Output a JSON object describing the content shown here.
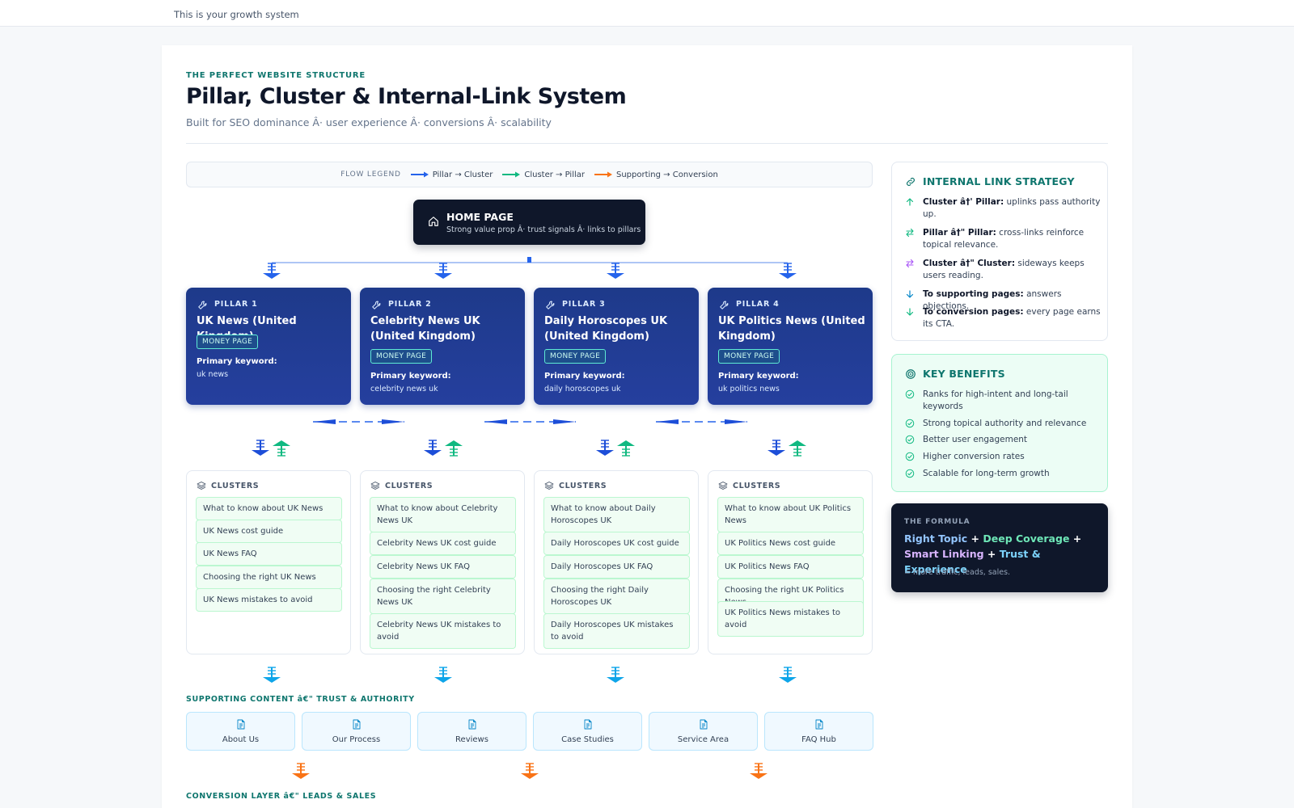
{
  "topbar": {
    "text": "This is your growth system"
  },
  "header": {
    "eyebrow": "THE PERFECT WEBSITE STRUCTURE",
    "title": "Pillar, Cluster & Internal-Link System",
    "subtitle": "Built for SEO dominance Â· user experience Â· conversions Â· scalability"
  },
  "legend": {
    "title": "FLOW LEGEND",
    "items": [
      {
        "label": "Pillar → Cluster",
        "color": "#2563eb"
      },
      {
        "label": "Cluster → Pillar",
        "color": "#10b981"
      },
      {
        "label": "Supporting → Conversion",
        "color": "#f97316"
      }
    ]
  },
  "home": {
    "title": "HOME PAGE",
    "subtitle": "Strong value prop Â· trust signals Â· links to pillars"
  },
  "pillars": [
    {
      "num": "PILLAR 1",
      "name": "UK News (United Kingdom)",
      "badge": "MONEY PAGE",
      "kw_label": "Primary keyword:",
      "kw": "uk news"
    },
    {
      "num": "PILLAR 2",
      "name": "Celebrity News UK (United Kingdom)",
      "badge": "MONEY PAGE",
      "kw_label": "Primary keyword:",
      "kw": "celebrity news uk"
    },
    {
      "num": "PILLAR 3",
      "name": "Daily Horoscopes UK (United Kingdom)",
      "badge": "MONEY PAGE",
      "kw_label": "Primary keyword:",
      "kw": "daily horoscopes uk"
    },
    {
      "num": "PILLAR 4",
      "name": "UK Politics News (United Kingdom)",
      "badge": "MONEY PAGE",
      "kw_label": "Primary keyword:",
      "kw": "uk politics news"
    }
  ],
  "clusters": [
    {
      "title": "CLUSTERS",
      "items": [
        "What to know about UK News",
        "UK News cost guide",
        "UK News FAQ",
        "Choosing the right UK News",
        "UK News mistakes to avoid"
      ]
    },
    {
      "title": "CLUSTERS",
      "items": [
        "What to know about Celebrity News UK",
        "Celebrity News UK cost guide",
        "Celebrity News UK FAQ",
        "Choosing the right Celebrity News UK",
        "Celebrity News UK mistakes to avoid"
      ]
    },
    {
      "title": "CLUSTERS",
      "items": [
        "What to know about Daily Horoscopes UK",
        "Daily Horoscopes UK cost guide",
        "Daily Horoscopes UK FAQ",
        "Choosing the right Daily Horoscopes UK",
        "Daily Horoscopes UK mistakes to avoid"
      ]
    },
    {
      "title": "CLUSTERS",
      "items": [
        "What to know about UK Politics News",
        "UK Politics News cost guide",
        "UK Politics News FAQ",
        "Choosing the right UK Politics News",
        "UK Politics News mistakes to avoid"
      ]
    }
  ],
  "supporting": {
    "label": "SUPPORTING CONTENT â€\" TRUST & AUTHORITY",
    "items": [
      "About Us",
      "Our Process",
      "Reviews",
      "Case Studies",
      "Service Area",
      "FAQ Hub"
    ]
  },
  "conversion": {
    "label": "CONVERSION LAYER â€\" LEADS & SALES"
  },
  "strategy": {
    "title": "INTERNAL LINK STRATEGY",
    "rows": [
      {
        "icon": "arrow-up-icon",
        "bold": "Cluster â†' Pillar:",
        "text": " uplinks pass authority up."
      },
      {
        "icon": "swap-icon",
        "bold": "Pillar â†\" Pillar:",
        "text": " cross-links reinforce topical relevance."
      },
      {
        "icon": "sideways-icon",
        "bold": "Cluster â†\" Cluster:",
        "text": " sideways keeps users reading."
      },
      {
        "icon": "arrow-down-icon",
        "bold": "To supporting pages:",
        "text": " answers objections."
      },
      {
        "icon": "arrow-down-icon",
        "bold": "To conversion pages:",
        "text": " every page earns its CTA."
      }
    ]
  },
  "benefits": {
    "title": "KEY BENEFITS",
    "items": [
      "Ranks for high-intent and long-tail keywords",
      "Strong topical authority and relevance",
      "Better user engagement",
      "Higher conversion rates",
      "Scalable for long-term growth"
    ]
  },
  "formula": {
    "tag": "THE FORMULA",
    "parts": [
      {
        "text": "Right Topic",
        "color": "#93c5fd"
      },
      {
        "text": " + ",
        "color": "#ffffff"
      },
      {
        "text": "Deep Coverage",
        "color": "#6ee7b7"
      },
      {
        "text": " + ",
        "color": "#ffffff"
      },
      {
        "text": "Smart Linking",
        "color": "#d8b4fe"
      },
      {
        "text": " + ",
        "color": "#ffffff"
      },
      {
        "text": "Trust & Experience",
        "color": "#7dd3fc"
      }
    ],
    "note": "= more traffic, leads, sales."
  },
  "colors": {
    "pillar_blue": "#1e3a8a",
    "accent_teal": "#0f766e",
    "arrow_blue": "#2563eb",
    "arrow_green": "#10b981",
    "arrow_orange": "#f97316",
    "arrow_sky": "#0ea5e9"
  }
}
